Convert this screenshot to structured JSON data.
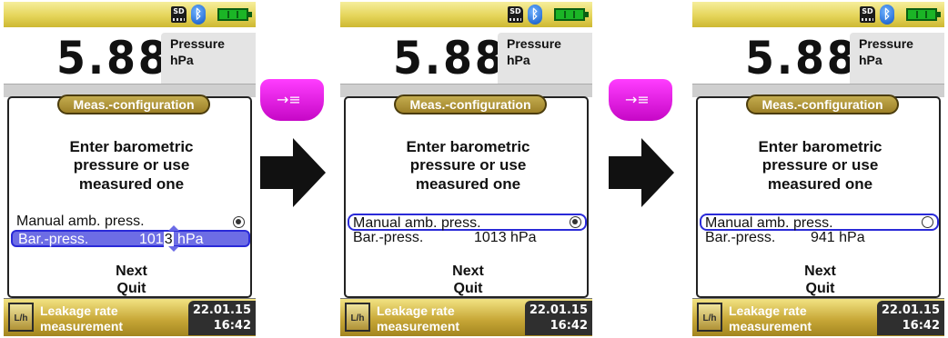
{
  "screens": [
    {
      "status": {
        "sd_icon": "SD"
      },
      "reading": {
        "value": "5.88",
        "label": "Pressure",
        "unit": "hPa"
      },
      "dialog": {
        "title": "Meas.-configuration",
        "instruction": [
          "Enter barometric",
          "pressure or use",
          "measured one"
        ],
        "option_manual": {
          "label": "Manual amb. press.",
          "state": "checked"
        },
        "option_bar": {
          "label": "Bar.-press.",
          "value_prefix": "101",
          "value_cursor": "3",
          "value_suffix": " hPa"
        },
        "menu": [
          "Next",
          "Quit"
        ]
      },
      "footer": {
        "title": [
          "Leakage rate",
          "measurement"
        ],
        "date": "22.01.15",
        "time": "16:42"
      }
    },
    {
      "status": {
        "sd_icon": "SD"
      },
      "reading": {
        "value": "5.88",
        "label": "Pressure",
        "unit": "hPa"
      },
      "dialog": {
        "title": "Meas.-configuration",
        "instruction": [
          "Enter barometric",
          "pressure or use",
          "measured one"
        ],
        "option_manual": {
          "label": "Manual amb. press.",
          "state": "checked"
        },
        "option_bar": {
          "label": "Bar.-press.",
          "value": "1013 hPa"
        },
        "menu": [
          "Next",
          "Quit"
        ]
      },
      "footer": {
        "title": [
          "Leakage rate",
          "measurement"
        ],
        "date": "22.01.15",
        "time": "16:42"
      }
    },
    {
      "status": {
        "sd_icon": "SD"
      },
      "reading": {
        "value": "5.88",
        "label": "Pressure",
        "unit": "hPa"
      },
      "dialog": {
        "title": "Meas.-configuration",
        "instruction": [
          "Enter barometric",
          "pressure or use",
          "measured one"
        ],
        "option_manual": {
          "label": "Manual amb. press.",
          "state": "unchecked"
        },
        "option_bar": {
          "label": "Bar.-press.",
          "value": "941 hPa"
        },
        "menu": [
          "Next",
          "Quit"
        ]
      },
      "footer": {
        "title": [
          "Leakage rate",
          "measurement"
        ],
        "date": "22.01.15",
        "time": "16:42"
      }
    }
  ],
  "transitions": [
    {
      "key_icon": "→≡",
      "key_name": "confirm-key-icon"
    },
    {
      "key_icon": "→≡",
      "key_name": "confirm-key-icon"
    }
  ],
  "colors": {
    "accent_magenta": "#e020e0",
    "selection_blue": "#2a2ad8",
    "header_yellow": "#e5d55a",
    "footer_gold": "#c7a737"
  }
}
